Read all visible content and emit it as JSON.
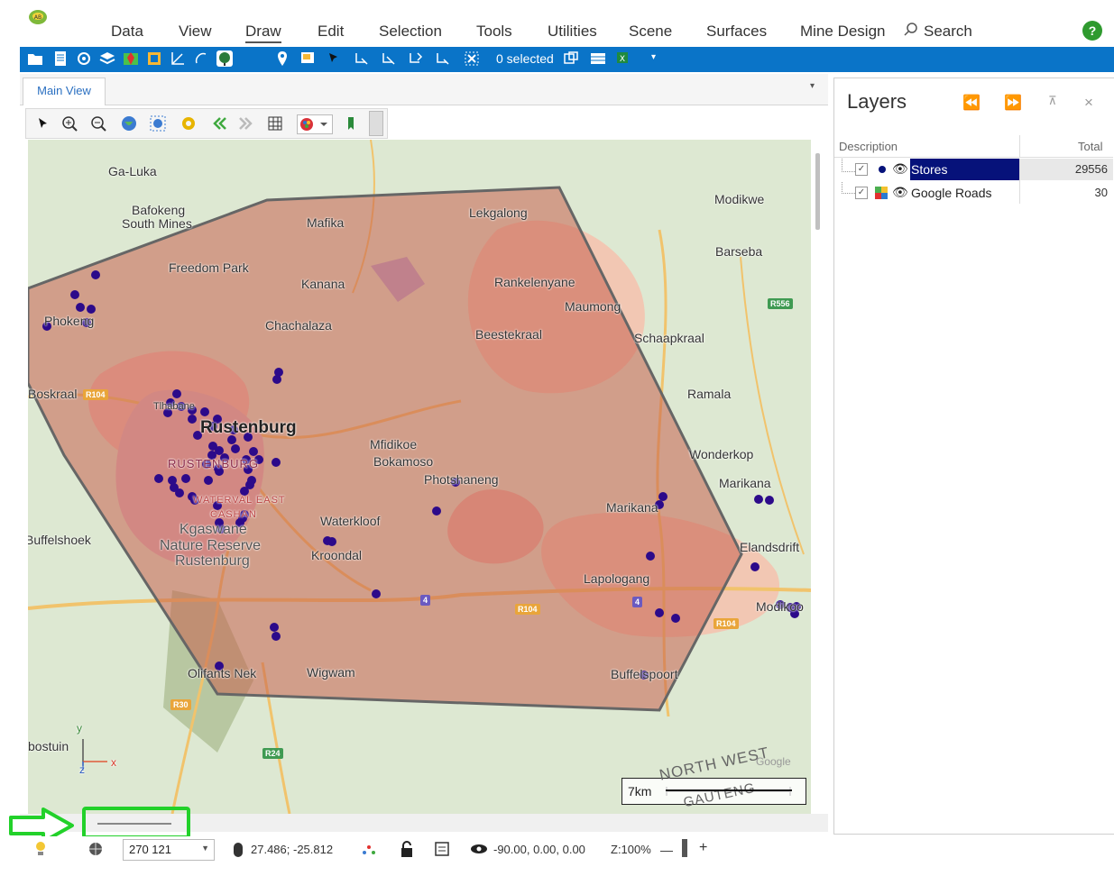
{
  "menu": {
    "items": [
      "Data",
      "View",
      "Draw",
      "Edit",
      "Selection",
      "Tools",
      "Utilities",
      "Scene",
      "Surfaces",
      "Mine Design"
    ],
    "search_label": "Search",
    "help_label": "?"
  },
  "toolbar": {
    "selected_count": "0 selected",
    "toolbar_color": "#0a74c8"
  },
  "view": {
    "tab_label": "Main View"
  },
  "map": {
    "places": [
      "Ga-Luka",
      "Bafokeng",
      "South Mines",
      "Mafika",
      "Lekgalong",
      "Modikwe",
      "Barseba",
      "Freedom Park",
      "Kanana",
      "Rankelenyane",
      "Maumong",
      "Phokeng",
      "Chachalaza",
      "Beestekraal",
      "Schaapkraal",
      "Ramala",
      "Rustenburg",
      "RUSTENBURG",
      "Mfidikoe",
      "Bokamoso",
      "Photshaneng",
      "Wonderkop",
      "Marikana",
      "WATERVAL EAST",
      "CASHAN",
      "Waterkloof",
      "Kgaswane",
      "Nature Reserve",
      "Rustenburg",
      "Buffelshoek",
      "Kroondal",
      "Elandsdrift",
      "Lapologang",
      "Marikana",
      "Modikoo",
      "Olifants Nek",
      "Wigwam",
      "Buffelspoort",
      "bostuin",
      "Tlhabane",
      "Boskraal"
    ],
    "road_badges": [
      "R104",
      "R556",
      "R104",
      "R104",
      "R30",
      "R24",
      "4",
      "4"
    ],
    "scale_label": "7km",
    "region_1": "NORTH WEST",
    "region_2": "GAUTENG",
    "watermark": "Google",
    "axis_labels": {
      "y": "y",
      "x": "x",
      "z": "z"
    },
    "polygon_fill": "#c76a5a",
    "point_color": "#2c0a8a"
  },
  "layers": {
    "title": "Layers",
    "col_description": "Description",
    "col_total": "Total",
    "rows": [
      {
        "name": "Stores",
        "total": "29556",
        "checked": "✓"
      },
      {
        "name": "Google Roads",
        "total": "30",
        "checked": "✓"
      }
    ]
  },
  "status": {
    "scale_value": "270 121",
    "coords": "27.486; -25.812",
    "view_angles": "-90.00, 0.00, 0.00",
    "zoom": "Z:100%",
    "zoom_minus": "—",
    "zoom_plus": "+"
  }
}
